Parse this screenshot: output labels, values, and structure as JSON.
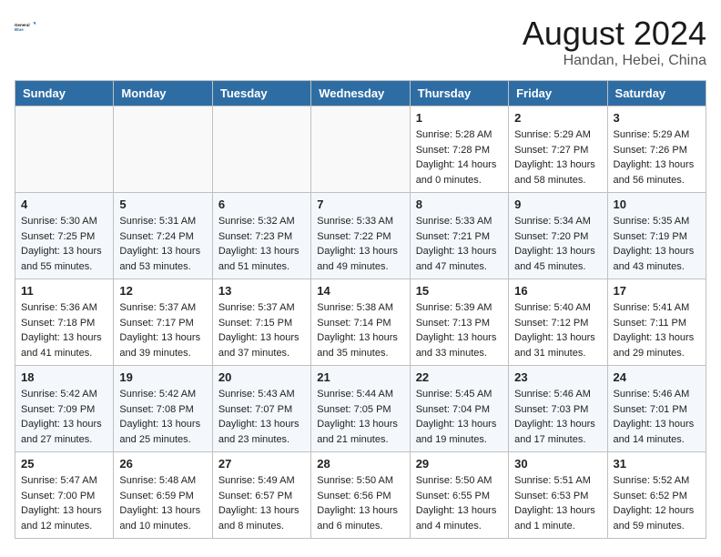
{
  "header": {
    "logo_general": "General",
    "logo_blue": "Blue",
    "month_title": "August 2024",
    "location": "Handan, Hebei, China"
  },
  "days_of_week": [
    "Sunday",
    "Monday",
    "Tuesday",
    "Wednesday",
    "Thursday",
    "Friday",
    "Saturday"
  ],
  "weeks": [
    [
      {
        "num": "",
        "sunrise": "",
        "sunset": "",
        "daylight": "",
        "empty": true
      },
      {
        "num": "",
        "sunrise": "",
        "sunset": "",
        "daylight": "",
        "empty": true
      },
      {
        "num": "",
        "sunrise": "",
        "sunset": "",
        "daylight": "",
        "empty": true
      },
      {
        "num": "",
        "sunrise": "",
        "sunset": "",
        "daylight": "",
        "empty": true
      },
      {
        "num": "1",
        "sunrise": "Sunrise: 5:28 AM",
        "sunset": "Sunset: 7:28 PM",
        "daylight": "Daylight: 14 hours and 0 minutes."
      },
      {
        "num": "2",
        "sunrise": "Sunrise: 5:29 AM",
        "sunset": "Sunset: 7:27 PM",
        "daylight": "Daylight: 13 hours and 58 minutes."
      },
      {
        "num": "3",
        "sunrise": "Sunrise: 5:29 AM",
        "sunset": "Sunset: 7:26 PM",
        "daylight": "Daylight: 13 hours and 56 minutes."
      }
    ],
    [
      {
        "num": "4",
        "sunrise": "Sunrise: 5:30 AM",
        "sunset": "Sunset: 7:25 PM",
        "daylight": "Daylight: 13 hours and 55 minutes."
      },
      {
        "num": "5",
        "sunrise": "Sunrise: 5:31 AM",
        "sunset": "Sunset: 7:24 PM",
        "daylight": "Daylight: 13 hours and 53 minutes."
      },
      {
        "num": "6",
        "sunrise": "Sunrise: 5:32 AM",
        "sunset": "Sunset: 7:23 PM",
        "daylight": "Daylight: 13 hours and 51 minutes."
      },
      {
        "num": "7",
        "sunrise": "Sunrise: 5:33 AM",
        "sunset": "Sunset: 7:22 PM",
        "daylight": "Daylight: 13 hours and 49 minutes."
      },
      {
        "num": "8",
        "sunrise": "Sunrise: 5:33 AM",
        "sunset": "Sunset: 7:21 PM",
        "daylight": "Daylight: 13 hours and 47 minutes."
      },
      {
        "num": "9",
        "sunrise": "Sunrise: 5:34 AM",
        "sunset": "Sunset: 7:20 PM",
        "daylight": "Daylight: 13 hours and 45 minutes."
      },
      {
        "num": "10",
        "sunrise": "Sunrise: 5:35 AM",
        "sunset": "Sunset: 7:19 PM",
        "daylight": "Daylight: 13 hours and 43 minutes."
      }
    ],
    [
      {
        "num": "11",
        "sunrise": "Sunrise: 5:36 AM",
        "sunset": "Sunset: 7:18 PM",
        "daylight": "Daylight: 13 hours and 41 minutes."
      },
      {
        "num": "12",
        "sunrise": "Sunrise: 5:37 AM",
        "sunset": "Sunset: 7:17 PM",
        "daylight": "Daylight: 13 hours and 39 minutes."
      },
      {
        "num": "13",
        "sunrise": "Sunrise: 5:37 AM",
        "sunset": "Sunset: 7:15 PM",
        "daylight": "Daylight: 13 hours and 37 minutes."
      },
      {
        "num": "14",
        "sunrise": "Sunrise: 5:38 AM",
        "sunset": "Sunset: 7:14 PM",
        "daylight": "Daylight: 13 hours and 35 minutes."
      },
      {
        "num": "15",
        "sunrise": "Sunrise: 5:39 AM",
        "sunset": "Sunset: 7:13 PM",
        "daylight": "Daylight: 13 hours and 33 minutes."
      },
      {
        "num": "16",
        "sunrise": "Sunrise: 5:40 AM",
        "sunset": "Sunset: 7:12 PM",
        "daylight": "Daylight: 13 hours and 31 minutes."
      },
      {
        "num": "17",
        "sunrise": "Sunrise: 5:41 AM",
        "sunset": "Sunset: 7:11 PM",
        "daylight": "Daylight: 13 hours and 29 minutes."
      }
    ],
    [
      {
        "num": "18",
        "sunrise": "Sunrise: 5:42 AM",
        "sunset": "Sunset: 7:09 PM",
        "daylight": "Daylight: 13 hours and 27 minutes."
      },
      {
        "num": "19",
        "sunrise": "Sunrise: 5:42 AM",
        "sunset": "Sunset: 7:08 PM",
        "daylight": "Daylight: 13 hours and 25 minutes."
      },
      {
        "num": "20",
        "sunrise": "Sunrise: 5:43 AM",
        "sunset": "Sunset: 7:07 PM",
        "daylight": "Daylight: 13 hours and 23 minutes."
      },
      {
        "num": "21",
        "sunrise": "Sunrise: 5:44 AM",
        "sunset": "Sunset: 7:05 PM",
        "daylight": "Daylight: 13 hours and 21 minutes."
      },
      {
        "num": "22",
        "sunrise": "Sunrise: 5:45 AM",
        "sunset": "Sunset: 7:04 PM",
        "daylight": "Daylight: 13 hours and 19 minutes."
      },
      {
        "num": "23",
        "sunrise": "Sunrise: 5:46 AM",
        "sunset": "Sunset: 7:03 PM",
        "daylight": "Daylight: 13 hours and 17 minutes."
      },
      {
        "num": "24",
        "sunrise": "Sunrise: 5:46 AM",
        "sunset": "Sunset: 7:01 PM",
        "daylight": "Daylight: 13 hours and 14 minutes."
      }
    ],
    [
      {
        "num": "25",
        "sunrise": "Sunrise: 5:47 AM",
        "sunset": "Sunset: 7:00 PM",
        "daylight": "Daylight: 13 hours and 12 minutes."
      },
      {
        "num": "26",
        "sunrise": "Sunrise: 5:48 AM",
        "sunset": "Sunset: 6:59 PM",
        "daylight": "Daylight: 13 hours and 10 minutes."
      },
      {
        "num": "27",
        "sunrise": "Sunrise: 5:49 AM",
        "sunset": "Sunset: 6:57 PM",
        "daylight": "Daylight: 13 hours and 8 minutes."
      },
      {
        "num": "28",
        "sunrise": "Sunrise: 5:50 AM",
        "sunset": "Sunset: 6:56 PM",
        "daylight": "Daylight: 13 hours and 6 minutes."
      },
      {
        "num": "29",
        "sunrise": "Sunrise: 5:50 AM",
        "sunset": "Sunset: 6:55 PM",
        "daylight": "Daylight: 13 hours and 4 minutes."
      },
      {
        "num": "30",
        "sunrise": "Sunrise: 5:51 AM",
        "sunset": "Sunset: 6:53 PM",
        "daylight": "Daylight: 13 hours and 1 minute."
      },
      {
        "num": "31",
        "sunrise": "Sunrise: 5:52 AM",
        "sunset": "Sunset: 6:52 PM",
        "daylight": "Daylight: 12 hours and 59 minutes."
      }
    ]
  ]
}
